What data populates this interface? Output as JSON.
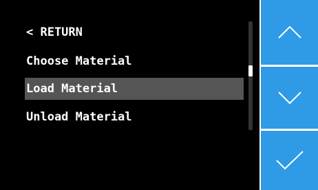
{
  "menu": {
    "items": [
      {
        "label": "< RETURN",
        "selected": false
      },
      {
        "label": "Choose Material",
        "selected": false
      },
      {
        "label": "Load Material",
        "selected": true
      },
      {
        "label": "Unload Material",
        "selected": false
      }
    ]
  },
  "scroll": {
    "position_fraction": 0.45
  },
  "buttons": {
    "up_icon": "chevron-up-icon",
    "down_icon": "chevron-down-icon",
    "confirm_icon": "checkmark-icon"
  },
  "colors": {
    "panel_background": "#000000",
    "selected_row": "#555555",
    "button_blue": "#2f9be6",
    "text": "#ffffff"
  }
}
